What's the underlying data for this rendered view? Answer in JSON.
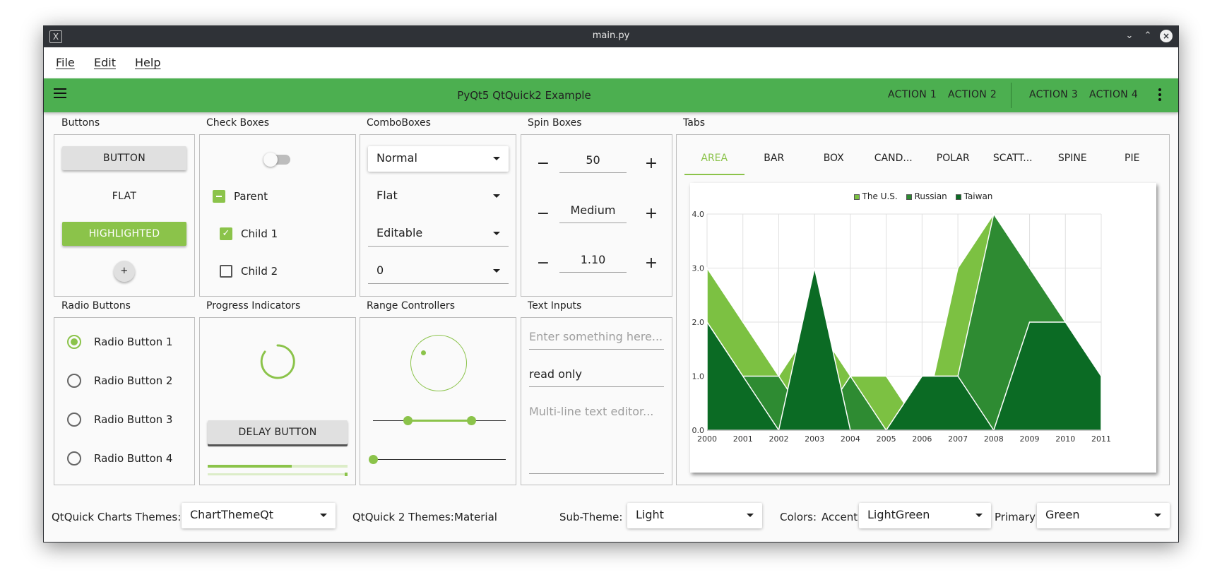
{
  "window": {
    "title": "main.py",
    "app_icon": "x-icon"
  },
  "menu": {
    "file": "File",
    "edit": "Edit",
    "help": "Help"
  },
  "toolbar": {
    "title": "PyQt5 QtQuick2 Example",
    "actions": [
      "ACTION 1",
      "ACTION 2",
      "ACTION 3",
      "ACTION 4"
    ]
  },
  "sections": {
    "buttons": "Buttons",
    "checkboxes": "Check Boxes",
    "comboboxes": "ComboBoxes",
    "spinboxes": "Spin Boxes",
    "tabs": "Tabs",
    "radio": "Radio Buttons",
    "progress": "Progress Indicators",
    "range": "Range Controllers",
    "text": "Text Inputs"
  },
  "buttons": {
    "button": "BUTTON",
    "flat": "FLAT",
    "highlighted": "HIGHLIGHTED",
    "round": "+"
  },
  "checkboxes": {
    "parent": "Parent",
    "child1": "Child 1",
    "child2": "Child 2",
    "switch_on": false
  },
  "combos": [
    "Normal",
    "Flat",
    "Editable",
    "0"
  ],
  "spins": [
    {
      "value": "50"
    },
    {
      "value": "Medium"
    },
    {
      "value": "1.10"
    }
  ],
  "spin_minus": "−",
  "spin_plus": "+",
  "radios": [
    "Radio Button 1",
    "Radio Button 2",
    "Radio Button 3",
    "Radio Button 4"
  ],
  "progress": {
    "delay_button": "DELAY BUTTON",
    "bar_value": 0.6
  },
  "range": {
    "dial": 0.3,
    "range_lo": 0.26,
    "range_hi": 0.74,
    "slider": 0.0
  },
  "text_inputs": {
    "placeholder1": "Enter something here...",
    "readonly": "read only",
    "placeholder2": "Multi-line text editor..."
  },
  "tabs": [
    "AREA",
    "BAR",
    "BOX",
    "CAND...",
    "POLAR",
    "SCATT...",
    "SPINE",
    "PIE"
  ],
  "colors": {
    "primary": "#4caf50",
    "accent": "#8bc34a",
    "us": "#7cc142",
    "russian": "#2e8b32",
    "taiwan": "#0b6b24"
  },
  "chart_data": {
    "type": "area",
    "x": [
      2000,
      2001,
      2002,
      2003,
      2004,
      2005,
      2006,
      2007,
      2008,
      2009,
      2010,
      2011
    ],
    "series": [
      {
        "name": "The U.S.",
        "values": [
          3,
          2,
          1,
          2,
          1,
          1,
          0,
          3,
          4,
          3,
          2,
          1
        ]
      },
      {
        "name": "Russian",
        "values": [
          2,
          1,
          1,
          0,
          1,
          0,
          1,
          1,
          4,
          3,
          2,
          1
        ]
      },
      {
        "name": "Taiwan",
        "values": [
          2,
          1,
          0,
          3,
          0,
          0,
          1,
          1,
          0,
          2,
          2,
          1
        ]
      }
    ],
    "yticks": [
      "0.0",
      "1.0",
      "2.0",
      "3.0",
      "4.0"
    ],
    "ylim": [
      0,
      4
    ],
    "legend": "top",
    "grid": true
  },
  "bottom": {
    "charts_label": "QtQuick Charts Themes:",
    "charts_value": "ChartThemeQt",
    "qq2_label": "QtQuick 2 Themes:",
    "qq2_value": "Material",
    "sub_label": "Sub-Theme:",
    "sub_value": "Light",
    "colors_label": "Colors:",
    "accent_label": "Accent",
    "accent_value": "LightGreen",
    "primary_label": "Primary",
    "primary_value": "Green"
  }
}
